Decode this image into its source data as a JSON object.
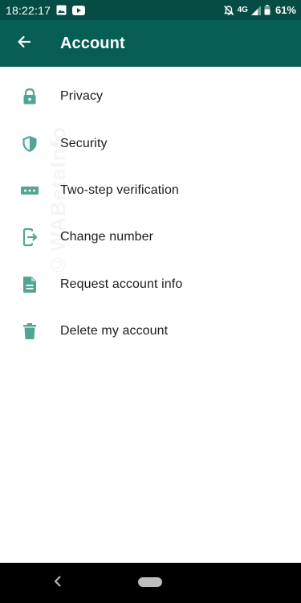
{
  "status_bar": {
    "time": "18:22:17",
    "network": "4G",
    "battery": "61%",
    "icons": [
      "gallery-icon",
      "youtube-icon",
      "silent-alarm-icon",
      "signal-icon",
      "battery-icon"
    ]
  },
  "app_bar": {
    "title": "Account",
    "back_icon": "arrow-back-icon",
    "color": "#075e54",
    "status_color": "#054d44"
  },
  "menu": {
    "accent": "#52a594",
    "items": [
      {
        "label": "Privacy",
        "icon": "lock-icon"
      },
      {
        "label": "Security",
        "icon": "shield-icon"
      },
      {
        "label": "Two-step verification",
        "icon": "dots-password-icon"
      },
      {
        "label": "Change number",
        "icon": "phone-change-icon"
      },
      {
        "label": "Request account info",
        "icon": "document-icon"
      },
      {
        "label": "Delete my account",
        "icon": "trash-icon"
      }
    ]
  },
  "watermark": {
    "text": "©WABetaInfo"
  },
  "nav_bar": {
    "back_icon": "nav-back-icon",
    "home_icon": "home-pill-icon"
  }
}
